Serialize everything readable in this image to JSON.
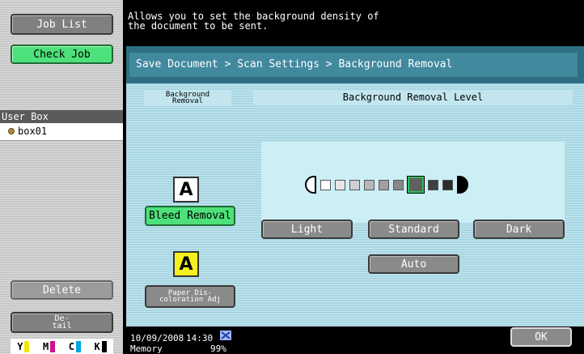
{
  "left_panel": {
    "job_list_label": "Job List",
    "check_job_label": "Check Job",
    "user_box_header": "User Box",
    "user_box_item": "box01",
    "delete_label": "Delete",
    "detail_label": "De-\ntail",
    "toner": [
      {
        "letter": "Y",
        "color": "#f3e600"
      },
      {
        "letter": "M",
        "color": "#d0108f"
      },
      {
        "letter": "C",
        "color": "#00a6e0"
      },
      {
        "letter": "K",
        "color": "#000000"
      }
    ]
  },
  "message": "Allows you to set the background density of\nthe document to be sent.",
  "breadcrumb": "Save Document > Scan Settings > Background Removal",
  "background_removal": {
    "section_label": "Background\nRemoval",
    "bleed_removal_label": "Bleed Removal",
    "bleed_icon_letter": "A",
    "paper_icon_letter": "A",
    "paper_adj_label": "Paper Dis-\ncoloration Adj"
  },
  "level": {
    "title": "Background Removal Level",
    "steps": [
      "#ffffff",
      "#e6e6e6",
      "#cfcfcf",
      "#b8b8b8",
      "#a0a0a0",
      "#888888",
      "#606060",
      "#404040",
      "#2c2c2c"
    ],
    "selected_step": 6,
    "light_label": "Light",
    "standard_label": "Standard",
    "dark_label": "Dark",
    "auto_label": "Auto"
  },
  "footer": {
    "date": "10/09/2008",
    "time": "14:30",
    "memory_label": "Memory",
    "memory_value": "99%",
    "ok_label": "OK"
  }
}
